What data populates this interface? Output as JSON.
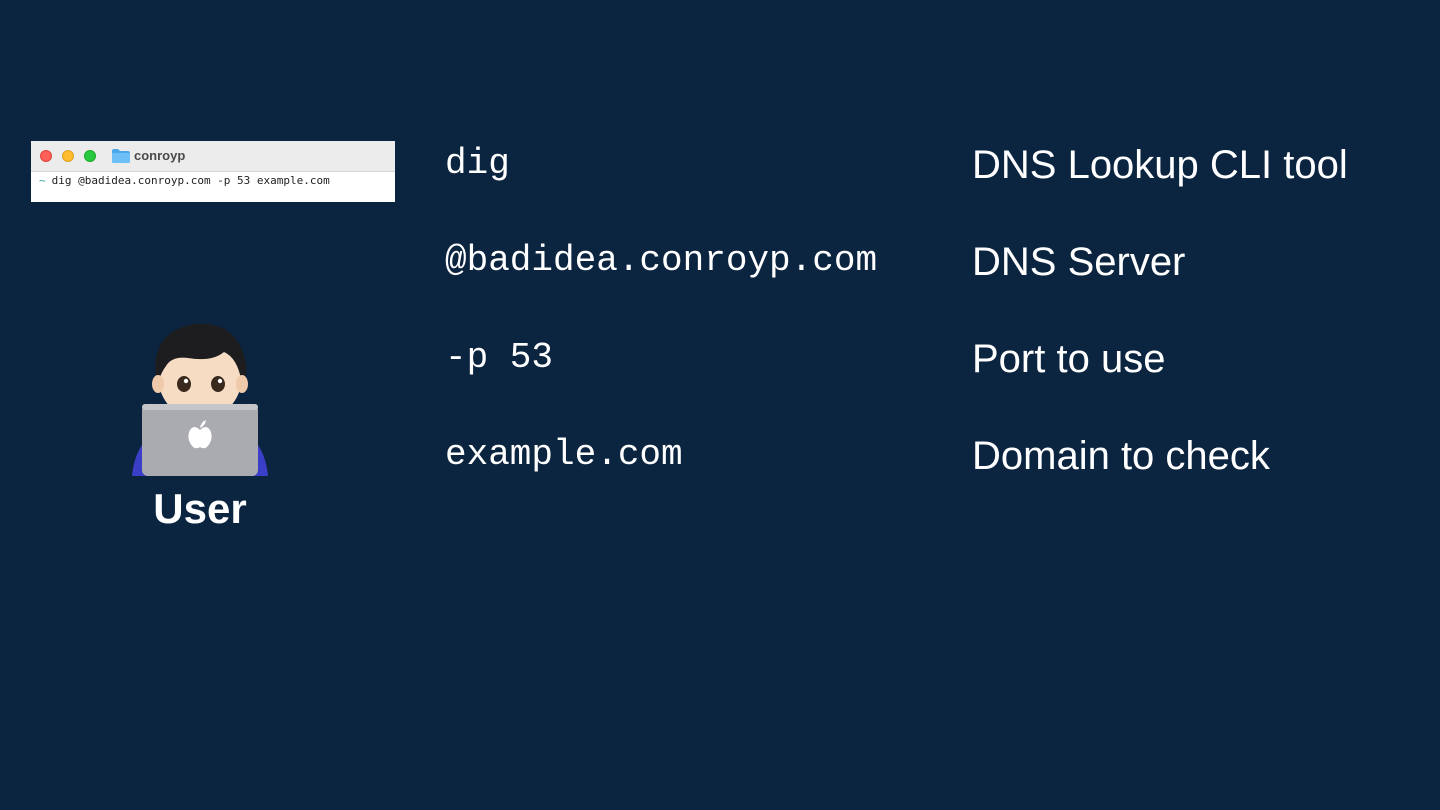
{
  "terminal": {
    "title": "conroyp",
    "prompt": "~",
    "command": "dig @badidea.conroyp.com -p 53 example.com",
    "icons": [
      "close-dot",
      "minimize-dot",
      "maximize-dot",
      "folder-icon"
    ]
  },
  "user": {
    "label": "User",
    "icon": "technologist-emoji"
  },
  "rows": [
    {
      "code": "dig",
      "description": "DNS Lookup CLI tool"
    },
    {
      "code": "@badidea.conroyp.com",
      "description": "DNS Server"
    },
    {
      "code": "-p 53",
      "description": "Port to use"
    },
    {
      "code": "example.com",
      "description": "Domain to check"
    }
  ],
  "colors": {
    "background": "#0b2440",
    "text": "#ffffff"
  }
}
